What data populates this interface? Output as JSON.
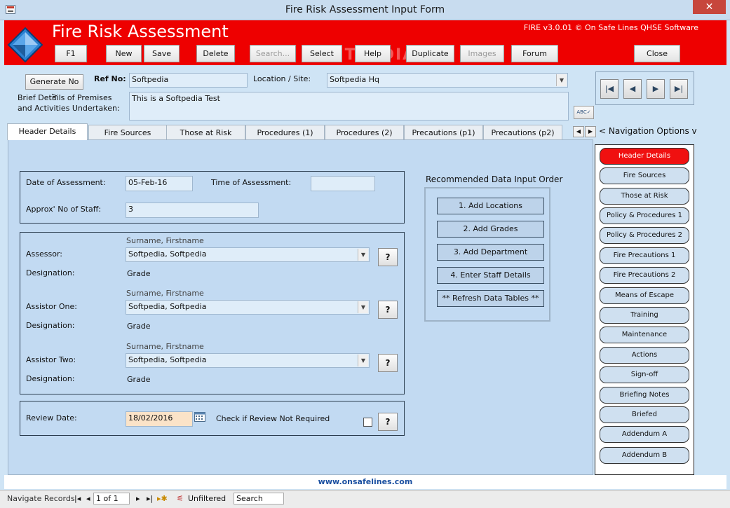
{
  "window": {
    "title": "Fire Risk Assessment Input Form",
    "close_glyph": "✕"
  },
  "header": {
    "app_title": "Fire Risk Assessment",
    "version": "FIRE v3.0.01 © On Safe Lines QHSE Software",
    "watermark": "SOFTPEDIA",
    "toolbar": [
      {
        "label": "F1",
        "enabled": true
      },
      {
        "label": "New",
        "enabled": true
      },
      {
        "label": "Save",
        "enabled": true
      },
      {
        "label": "Delete",
        "enabled": true
      },
      {
        "label": "Search...",
        "enabled": false
      },
      {
        "label": "Select",
        "enabled": true
      },
      {
        "label": "Help",
        "enabled": true
      },
      {
        "label": "Duplicate",
        "enabled": true
      },
      {
        "label": "Images",
        "enabled": false
      },
      {
        "label": "Forum",
        "enabled": true
      }
    ],
    "close_label": "Close"
  },
  "top_form": {
    "generate_btn": "Generate No >",
    "ref_label": "Ref No:",
    "ref_value": "Softpedia",
    "location_label": "Location / Site:",
    "location_value": "Softpedia Hq",
    "brief_label_1": "Brief Details of Premises",
    "brief_label_2": "and Activities Undertaken:",
    "brief_value": "This is a Softpedia Test",
    "spell_icon": "ABC✓"
  },
  "record_nav": {
    "first": "|◀",
    "prev": "◀",
    "next": "▶",
    "last": "▶|"
  },
  "tabs": [
    "Header Details",
    "Fire Sources",
    "Those at Risk",
    "Procedures (1)",
    "Procedures (2)",
    "Precautions (p1)",
    "Precautions (p2)"
  ],
  "tab_scroll": {
    "left": "◀",
    "right": "▶"
  },
  "nav_options_label": "< Navigation Options v",
  "assessment": {
    "date_label": "Date of Assessment:",
    "date_value": "05-Feb-16",
    "time_label": "Time of Assessment:",
    "time_value": "",
    "staff_label": "Approx' No of Staff:",
    "staff_value": "3"
  },
  "people": {
    "hint": "Surname, Firstname",
    "designation_label": "Designation:",
    "q": "?",
    "rows": [
      {
        "label": "Assessor:",
        "value": "Softpedia, Softpedia",
        "designation": "Grade"
      },
      {
        "label": "Assistor One:",
        "value": "Softpedia, Softpedia",
        "designation": "Grade"
      },
      {
        "label": "Assistor Two:",
        "value": "Softpedia, Softpedia",
        "designation": "Grade"
      }
    ]
  },
  "review": {
    "label": "Review Date:",
    "value": "18/02/2016",
    "check_label": "Check if Review Not Required",
    "checked": false
  },
  "recommended": {
    "title": "Recommended Data Input Order",
    "buttons": [
      "1. Add Locations",
      "2. Add Grades",
      "3. Add Department",
      "4. Enter Staff Details",
      "** Refresh Data Tables **"
    ]
  },
  "right_nav": {
    "items": [
      "Header Details",
      "Fire Sources",
      "Those at Risk",
      "Policy & Procedures 1",
      "Policy & Procedures 2",
      "Fire Precautions 1",
      "Fire Precautions 2",
      "Means of Escape",
      "Training",
      "Maintenance",
      "Actions",
      "Sign-off",
      "Briefing Notes",
      "Briefed",
      "Addendum A",
      "Addendum B"
    ],
    "active_index": 0
  },
  "footer": {
    "url": "www.onsafelines.com"
  },
  "status": {
    "nav_label": "Navigate Records",
    "record": "1 of 1",
    "filter": "Unfiltered",
    "search": "Search"
  },
  "colors": {
    "header_red": "#ee0000",
    "active_nav": "#f01010",
    "panel_blue": "#c2daf2"
  }
}
